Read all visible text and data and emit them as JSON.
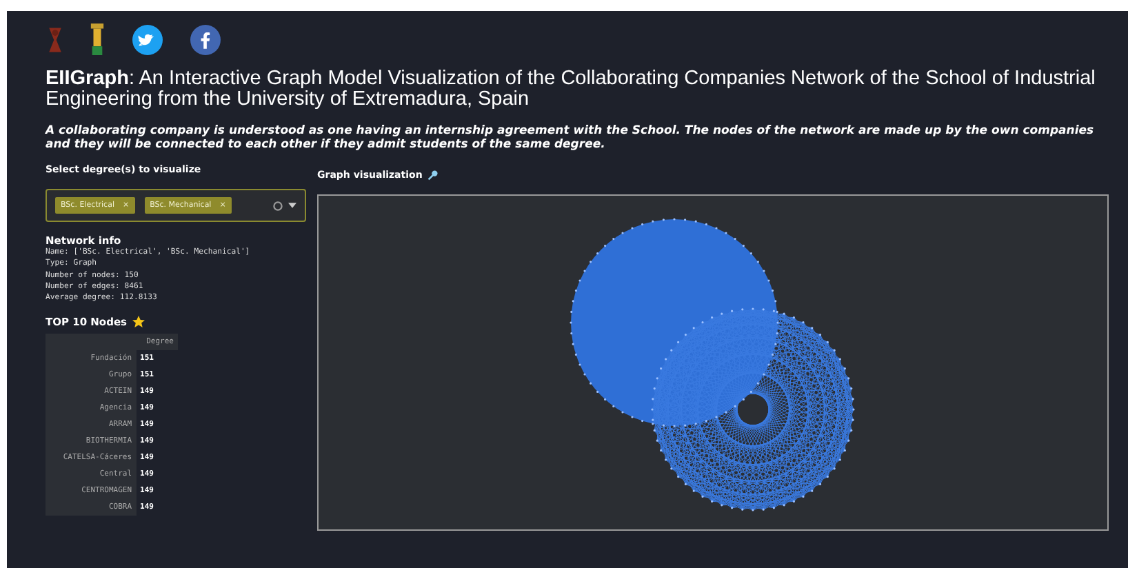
{
  "title": "**EIIGraph**: An Interactive Graph Model Visualization of the Collaborating Companies Network of the School of Industrial Engineering from the University of Extremadura, Spain",
  "description": "A collaborating company is understood as one having an **internship** agreement with the School. The nodes of the network are made up by the own companies and they will be connected to each other if they admit students of the same degree.",
  "degree_select": {
    "label": "Select degree(s) to visualize",
    "tags": [
      {
        "label": "BSc. Electrical",
        "remove": "×"
      },
      {
        "label": "BSc. Mechanical",
        "remove": "×"
      }
    ]
  },
  "network_info": {
    "heading": "Network info",
    "lines": [
      "Name: ['BSc. Electrical', 'BSc. Mechanical']",
      "Type: Graph",
      "Number of nodes: 150",
      "Number of edges: 8461",
      "Average degree: 112.8133"
    ]
  },
  "top_nodes": {
    "heading": "TOP 10 Nodes",
    "column": "Degree",
    "rows": [
      {
        "name": "Fundación",
        "degree": "151"
      },
      {
        "name": "Grupo",
        "degree": "151"
      },
      {
        "name": "ACTEIN",
        "degree": "149"
      },
      {
        "name": "Agencia",
        "degree": "149"
      },
      {
        "name": "ARRAM",
        "degree": "149"
      },
      {
        "name": "BIOTHERMIA",
        "degree": "149"
      },
      {
        "name": "CATELSA-Cáceres",
        "degree": "149"
      },
      {
        "name": "Central",
        "degree": "149"
      },
      {
        "name": "CENTROMAGEN",
        "degree": "149"
      },
      {
        "name": "COBRA",
        "degree": "149"
      }
    ]
  },
  "graph": {
    "heading": "Graph visualization"
  }
}
